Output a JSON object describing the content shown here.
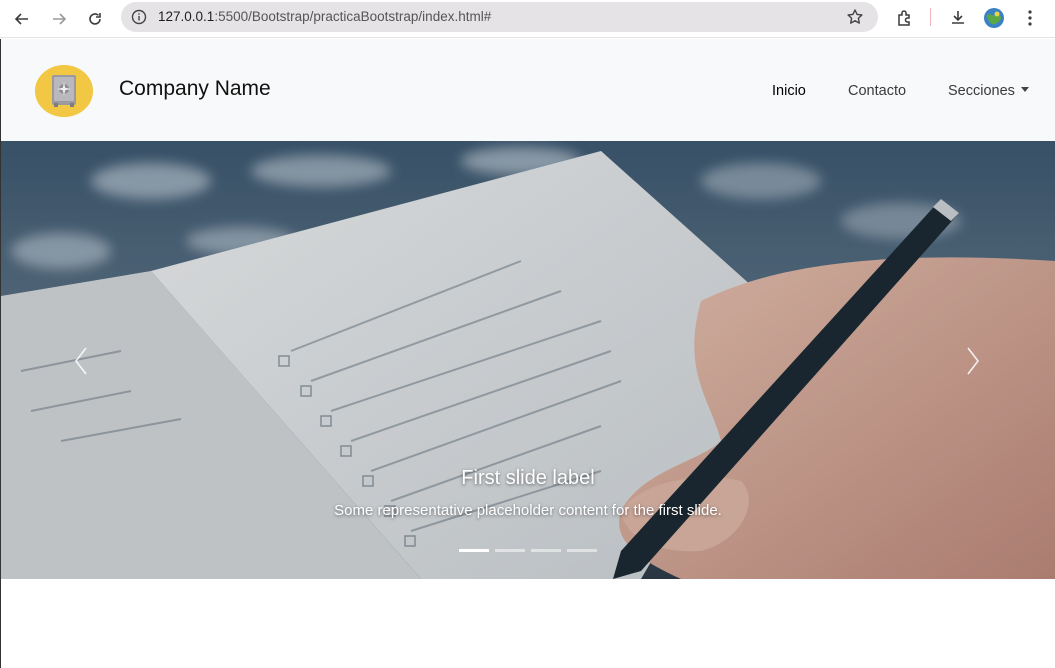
{
  "browser": {
    "url_host": "127.0.0.1",
    "url_path": ":5500/Bootstrap/practicaBootstrap/index.html#"
  },
  "navbar": {
    "brand": "Company Name",
    "links": [
      {
        "label": "Inicio",
        "active": true
      },
      {
        "label": "Contacto",
        "active": false
      },
      {
        "label": "Secciones",
        "active": false,
        "dropdown": true
      }
    ]
  },
  "carousel": {
    "title": "First slide label",
    "text": "Some representative placeholder content for the first slide.",
    "indicators": [
      true,
      false,
      false,
      false
    ]
  }
}
